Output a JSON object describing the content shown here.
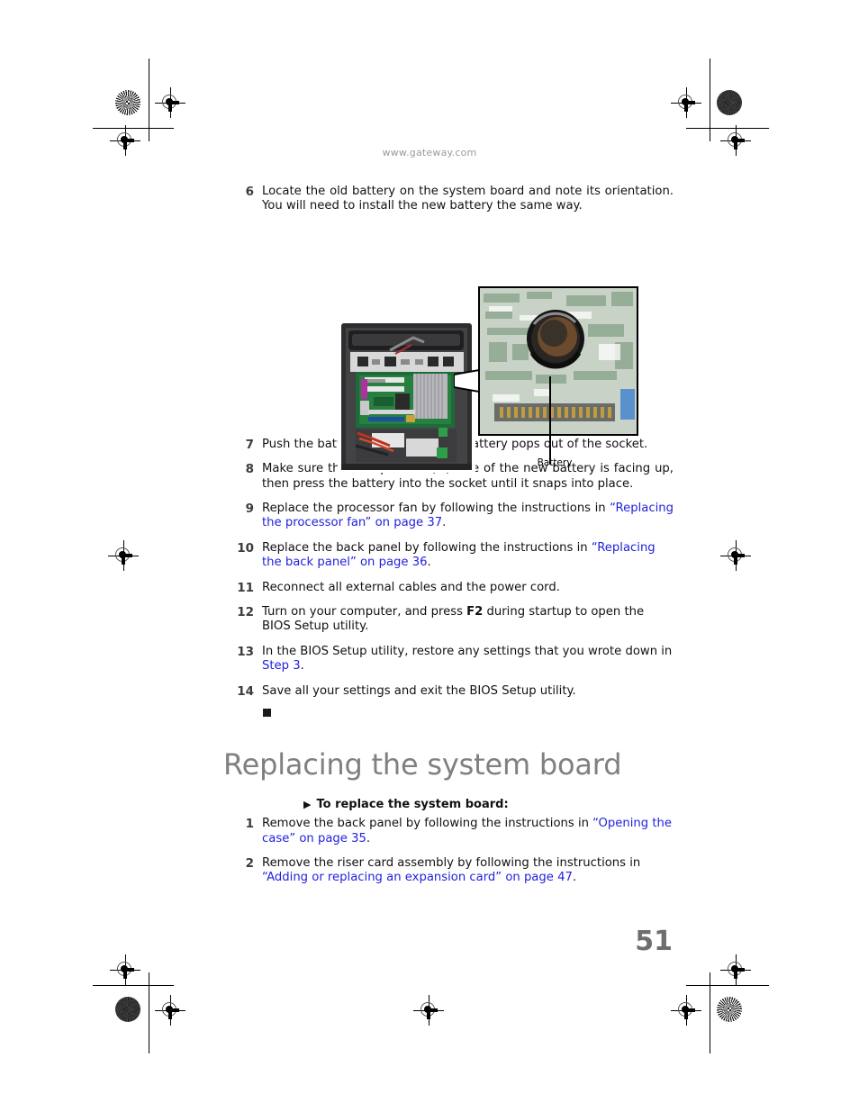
{
  "page": {
    "site_url": "www.gateway.com",
    "page_number": "51",
    "link_color": "#2222dd",
    "heading_color": "#808080"
  },
  "steps_battery": [
    {
      "num": "6",
      "parts": [
        {
          "t": "Locate the old battery on the system board and note its orientation. You will need to install the new battery the same way.",
          "k": "plain"
        }
      ]
    },
    {
      "num": "7",
      "parts": [
        {
          "t": "Push the battery release tab. The battery pops out of the socket.",
          "k": "plain"
        }
      ]
    },
    {
      "num": "8",
      "parts": [
        {
          "t": "Make sure that the positive (+) side of the new battery is facing up, then press the battery into the socket until it snaps into place.",
          "k": "plain"
        }
      ]
    },
    {
      "num": "9",
      "parts": [
        {
          "t": "Replace the processor fan by following the instructions in ",
          "k": "plain"
        },
        {
          "t": "“Replacing the processor fan” on page 37",
          "k": "link"
        },
        {
          "t": ".",
          "k": "plain"
        }
      ]
    },
    {
      "num": "10",
      "parts": [
        {
          "t": "Replace the back panel by following the instructions in ",
          "k": "plain"
        },
        {
          "t": "“Replacing the back panel” on page 36",
          "k": "link"
        },
        {
          "t": ".",
          "k": "plain"
        }
      ]
    },
    {
      "num": "11",
      "parts": [
        {
          "t": "Reconnect all external cables and the power cord.",
          "k": "plain"
        }
      ]
    },
    {
      "num": "12",
      "parts": [
        {
          "t": "Turn on your computer, and press ",
          "k": "plain"
        },
        {
          "t": "F2",
          "k": "bold"
        },
        {
          "t": " during startup to open the BIOS Setup utility.",
          "k": "plain"
        }
      ]
    },
    {
      "num": "13",
      "parts": [
        {
          "t": "In the BIOS Setup utility, restore any settings that you wrote down in ",
          "k": "plain"
        },
        {
          "t": "Step 3",
          "k": "link"
        },
        {
          "t": ".",
          "k": "plain"
        }
      ]
    },
    {
      "num": "14",
      "parts": [
        {
          "t": "Save all your settings and exit the BIOS Setup utility.",
          "k": "plain"
        }
      ]
    }
  ],
  "figure": {
    "label": "Battery",
    "alt": "Computer case interior with inset close-up of the system board battery"
  },
  "section": {
    "heading": "Replacing the system board",
    "subheading": "To replace the system board:",
    "bullet_glyph": "▶"
  },
  "steps_board": [
    {
      "num": "1",
      "parts": [
        {
          "t": "Remove the back panel by following the instructions in ",
          "k": "plain"
        },
        {
          "t": "“Opening the case” on page 35",
          "k": "link"
        },
        {
          "t": ".",
          "k": "plain"
        }
      ]
    },
    {
      "num": "2",
      "parts": [
        {
          "t": "Remove the riser card assembly by following the instructions in ",
          "k": "plain"
        },
        {
          "t": "“Adding or replacing an expansion card” on page 47",
          "k": "link"
        },
        {
          "t": ".",
          "k": "plain"
        }
      ]
    }
  ]
}
